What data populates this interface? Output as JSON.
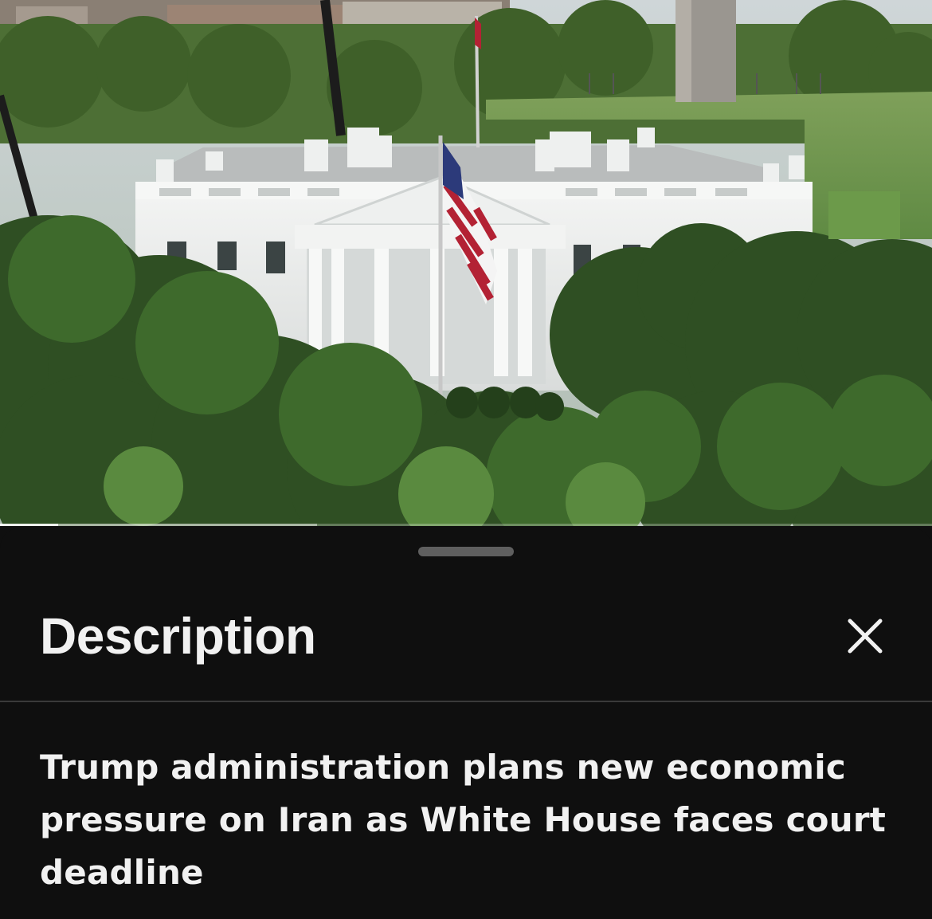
{
  "video": {
    "scene": "White House north facade with American flag",
    "progress_fraction": 0.062,
    "buffered_fraction": 0.34
  },
  "sheet": {
    "title": "Description",
    "close_icon": "close-icon",
    "headline": "Trump administration plans new economic pressure on Iran as White House faces court deadline"
  },
  "colors": {
    "sheet_background": "#0f0f0f",
    "text": "#f1f1f1",
    "divider": "#3a3a3a"
  }
}
